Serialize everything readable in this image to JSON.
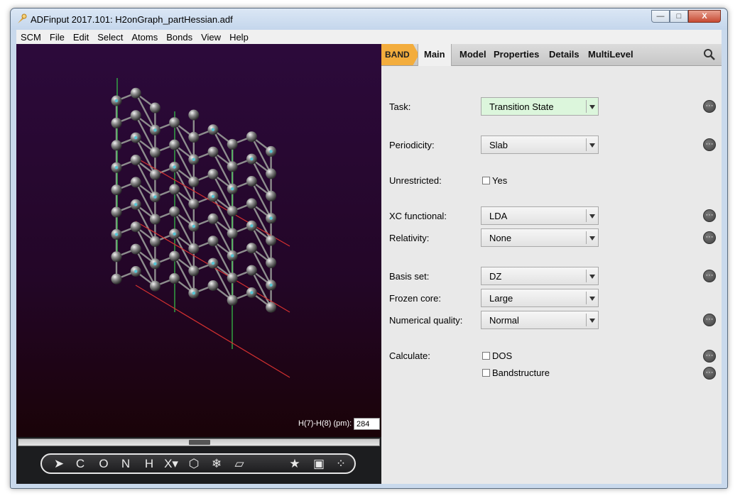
{
  "window": {
    "title": "ADFinput 2017.101: H2onGraph_partHessian.adf",
    "controls": {
      "minimize": "—",
      "maximize": "□",
      "close": "X"
    }
  },
  "menu": [
    "SCM",
    "File",
    "Edit",
    "Select",
    "Atoms",
    "Bonds",
    "View",
    "Help"
  ],
  "viewer": {
    "measurement_label": "H(7)-H(8) (pm):",
    "measurement_value": "284"
  },
  "toolbar": {
    "tools": [
      {
        "name": "select-tool",
        "glyph": "➤"
      },
      {
        "name": "carbon-tool",
        "glyph": "C"
      },
      {
        "name": "oxygen-tool",
        "glyph": "O"
      },
      {
        "name": "nitrogen-tool",
        "glyph": "N"
      },
      {
        "name": "hydrogen-tool",
        "glyph": "H"
      },
      {
        "name": "other-element-tool",
        "glyph": "X▾"
      },
      {
        "name": "ring-tool",
        "glyph": "⬡"
      },
      {
        "name": "freeze-tool",
        "glyph": "❄"
      },
      {
        "name": "plane-tool",
        "glyph": "▱"
      },
      {
        "name": "favorites-tool",
        "glyph": "★"
      },
      {
        "name": "lattice-tool",
        "glyph": "▣"
      },
      {
        "name": "structure-tool",
        "glyph": "⁘"
      }
    ]
  },
  "panel": {
    "engine_tab": "BAND",
    "tabs": [
      "Main",
      "Model",
      "Properties",
      "Details",
      "MultiLevel"
    ],
    "active_tab": "Main",
    "fields": {
      "task": {
        "label": "Task:",
        "value": "Transition State"
      },
      "periodicity": {
        "label": "Periodicity:",
        "value": "Slab"
      },
      "unrestricted": {
        "label": "Unrestricted:",
        "option": "Yes",
        "checked": false
      },
      "xc_functional": {
        "label": "XC functional:",
        "value": "LDA"
      },
      "relativity": {
        "label": "Relativity:",
        "value": "None"
      },
      "basis_set": {
        "label": "Basis set:",
        "value": "DZ"
      },
      "frozen_core": {
        "label": "Frozen core:",
        "value": "Large"
      },
      "numerical_quality": {
        "label": "Numerical quality:",
        "value": "Normal"
      },
      "calculate": {
        "label": "Calculate:",
        "options": [
          {
            "label": "DOS",
            "checked": false
          },
          {
            "label": "Bandstructure",
            "checked": false
          }
        ]
      }
    },
    "more_glyph": "···"
  },
  "colors": {
    "band_accent": "#f3ad3d",
    "task_highlight": "#dcf6dc",
    "viewer_background": "#2a0a37",
    "red_line": "#d43030",
    "green_line": "#36c94a"
  }
}
